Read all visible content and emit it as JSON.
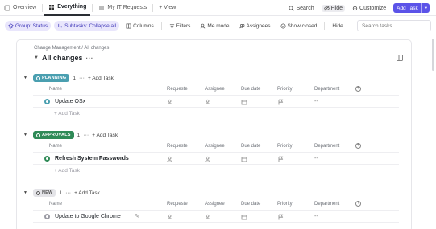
{
  "view_tabs": [
    {
      "label": "Overview",
      "icon": "overview-icon"
    },
    {
      "label": "Everything",
      "icon": "everything-icon",
      "active": true
    },
    {
      "label": "My IT Requests",
      "icon": "list-icon"
    },
    {
      "label": "+ View",
      "icon": "add-view-icon"
    }
  ],
  "toolbar": {
    "search_label": "Search",
    "hide_label": "Hide",
    "customize_label": "Customize",
    "add_task_label": "Add Task"
  },
  "filters": {
    "group": "Group: Status",
    "subtasks": "Subtasks: Collapse all",
    "columns": "Columns",
    "filters": "Filters",
    "me_mode": "Me mode",
    "assignees": "Assignees",
    "show_closed": "Show closed",
    "hide": "Hide",
    "search_placeholder": "Search tasks..."
  },
  "panel": {
    "breadcrumb": "Change Management / All changes",
    "title": "All changes",
    "title_more": "···"
  },
  "columns": {
    "name": "Name",
    "requester": "Requeste",
    "assignee": "Assignee",
    "due_date": "Due date",
    "priority": "Priority",
    "department": "Department"
  },
  "groups": [
    {
      "status": "PLANNING",
      "count": "1",
      "more": "···",
      "add_label": "+ Add Task",
      "task": {
        "name": "Update OSx",
        "department": "--"
      },
      "add_row": "+ Add Task"
    },
    {
      "status": "APPROVALS",
      "count": "1",
      "more": "···",
      "add_label": "+ Add Task",
      "task": {
        "name": "Refresh System Passwords",
        "department": "--"
      },
      "add_row": "+ Add Task"
    },
    {
      "status": "NEW",
      "count": "1",
      "more": "···",
      "add_label": "+ Add Task",
      "task": {
        "name": "Update to Google Chrome",
        "department": "--"
      },
      "add_row": ""
    }
  ],
  "colors": {
    "accent": "#5b53e8",
    "planning": "#4a9fb0",
    "approvals": "#2f8a57",
    "new": "#e4e4e8"
  }
}
